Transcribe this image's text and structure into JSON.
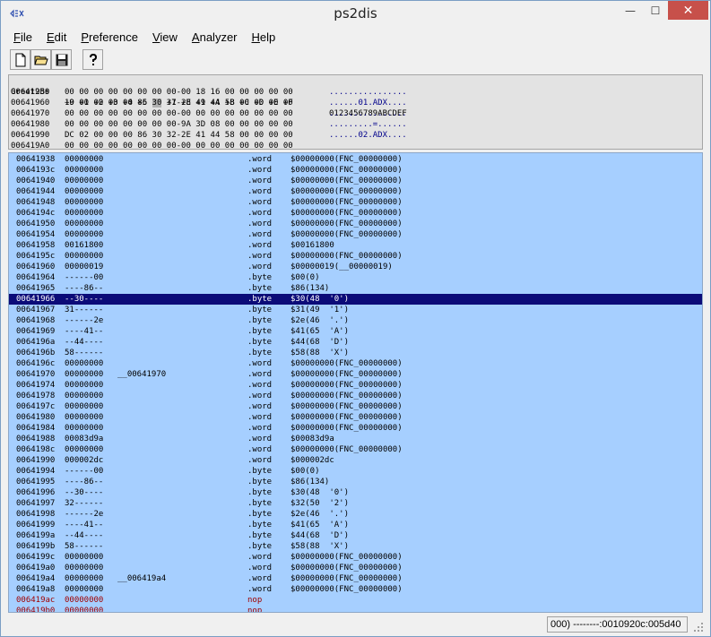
{
  "window": {
    "title": "ps2dis",
    "min_glyph": "—",
    "max_glyph": "☐",
    "close_glyph": "✕"
  },
  "menu": [
    {
      "key": "F",
      "rest": "ile"
    },
    {
      "key": "E",
      "rest": "dit"
    },
    {
      "key": "P",
      "rest": "reference"
    },
    {
      "key": "V",
      "rest": "iew"
    },
    {
      "key": "A",
      "rest": "nalyzer"
    },
    {
      "key": "H",
      "rest": "elp"
    }
  ],
  "toolbar": [
    "new-file-icon",
    "open-folder-icon",
    "save-disk-icon",
    "help-icon"
  ],
  "hexview": {
    "header": {
      "addr": "Greet2Bs",
      "bytes": "+0 +1 +2 +3 +4 +5 +6 +7 +8 +9 +A +B +C +D +E +F",
      "ascii": "0123456789ABCDEF"
    },
    "rows": [
      {
        "addr": "00641950",
        "bytes": "00 00 00 00 00 00 00 00-00 18 16 00 00 00 00 00",
        "ascii": "................"
      },
      {
        "addr": "00641960",
        "bytes": "19 00 00 00 00 86 30 31-2E 41 44 58 00 00 00 00",
        "ascii": "......01.ADX...."
      },
      {
        "addr": "00641970",
        "bytes": "00 00 00 00 00 00 00 00-00 00 00 00 00 00 00 00",
        "ascii": "................"
      },
      {
        "addr": "00641980",
        "bytes": "00 00 00 00 00 00 00 00-9A 3D 08 00 00 00 00 00",
        "ascii": ".........=......"
      },
      {
        "addr": "00641990",
        "bytes": "DC 02 00 00 00 86 30 32-2E 41 44 58 00 00 00 00",
        "ascii": "......02.ADX...."
      },
      {
        "addr": "006419A0",
        "bytes": "00 00 00 00 00 00 00 00-00 00 00 00 00 00 00 00",
        "ascii": ""
      }
    ]
  },
  "disasm": [
    {
      "addr": "00641938",
      "val": "00000000",
      "label": "",
      "op": ".word",
      "arg": "$00000000(FNC_00000000)"
    },
    {
      "addr": "0064193c",
      "val": "00000000",
      "label": "",
      "op": ".word",
      "arg": "$00000000(FNC_00000000)"
    },
    {
      "addr": "00641940",
      "val": "00000000",
      "label": "",
      "op": ".word",
      "arg": "$00000000(FNC_00000000)"
    },
    {
      "addr": "00641944",
      "val": "00000000",
      "label": "",
      "op": ".word",
      "arg": "$00000000(FNC_00000000)"
    },
    {
      "addr": "00641948",
      "val": "00000000",
      "label": "",
      "op": ".word",
      "arg": "$00000000(FNC_00000000)"
    },
    {
      "addr": "0064194c",
      "val": "00000000",
      "label": "",
      "op": ".word",
      "arg": "$00000000(FNC_00000000)"
    },
    {
      "addr": "00641950",
      "val": "00000000",
      "label": "",
      "op": ".word",
      "arg": "$00000000(FNC_00000000)"
    },
    {
      "addr": "00641954",
      "val": "00000000",
      "label": "",
      "op": ".word",
      "arg": "$00000000(FNC_00000000)"
    },
    {
      "addr": "00641958",
      "val": "00161800",
      "label": "",
      "op": ".word",
      "arg": "$00161800"
    },
    {
      "addr": "0064195c",
      "val": "00000000",
      "label": "",
      "op": ".word",
      "arg": "$00000000(FNC_00000000)"
    },
    {
      "addr": "00641960",
      "val": "00000019",
      "label": "",
      "op": ".word",
      "arg": "$00000019(__00000019)"
    },
    {
      "addr": "00641964",
      "val": "------00",
      "label": "",
      "op": ".byte",
      "arg": "$00(0)"
    },
    {
      "addr": "00641965",
      "val": "----86--",
      "label": "",
      "op": ".byte",
      "arg": "$86(134)"
    },
    {
      "addr": "00641966",
      "val": "--30----",
      "label": "",
      "op": ".byte",
      "arg": "$30(48  '0')"
    },
    {
      "addr": "00641967",
      "val": "31------",
      "label": "",
      "op": ".byte",
      "arg": "$31(49  '1')"
    },
    {
      "addr": "00641968",
      "val": "------2e",
      "label": "",
      "op": ".byte",
      "arg": "$2e(46  '.')"
    },
    {
      "addr": "00641969",
      "val": "----41--",
      "label": "",
      "op": ".byte",
      "arg": "$41(65  'A')"
    },
    {
      "addr": "0064196a",
      "val": "--44----",
      "label": "",
      "op": ".byte",
      "arg": "$44(68  'D')"
    },
    {
      "addr": "0064196b",
      "val": "58------",
      "label": "",
      "op": ".byte",
      "arg": "$58(88  'X')"
    },
    {
      "addr": "0064196c",
      "val": "00000000",
      "label": "",
      "op": ".word",
      "arg": "$00000000(FNC_00000000)"
    },
    {
      "addr": "00641970",
      "val": "00000000",
      "label": "__00641970",
      "op": ".word",
      "arg": "$00000000(FNC_00000000)"
    },
    {
      "addr": "00641974",
      "val": "00000000",
      "label": "",
      "op": ".word",
      "arg": "$00000000(FNC_00000000)"
    },
    {
      "addr": "00641978",
      "val": "00000000",
      "label": "",
      "op": ".word",
      "arg": "$00000000(FNC_00000000)"
    },
    {
      "addr": "0064197c",
      "val": "00000000",
      "label": "",
      "op": ".word",
      "arg": "$00000000(FNC_00000000)"
    },
    {
      "addr": "00641980",
      "val": "00000000",
      "label": "",
      "op": ".word",
      "arg": "$00000000(FNC_00000000)"
    },
    {
      "addr": "00641984",
      "val": "00000000",
      "label": "",
      "op": ".word",
      "arg": "$00000000(FNC_00000000)"
    },
    {
      "addr": "00641988",
      "val": "00083d9a",
      "label": "",
      "op": ".word",
      "arg": "$00083d9a"
    },
    {
      "addr": "0064198c",
      "val": "00000000",
      "label": "",
      "op": ".word",
      "arg": "$00000000(FNC_00000000)"
    },
    {
      "addr": "00641990",
      "val": "000002dc",
      "label": "",
      "op": ".word",
      "arg": "$000002dc"
    },
    {
      "addr": "00641994",
      "val": "------00",
      "label": "",
      "op": ".byte",
      "arg": "$00(0)"
    },
    {
      "addr": "00641995",
      "val": "----86--",
      "label": "",
      "op": ".byte",
      "arg": "$86(134)"
    },
    {
      "addr": "00641996",
      "val": "--30----",
      "label": "",
      "op": ".byte",
      "arg": "$30(48  '0')"
    },
    {
      "addr": "00641997",
      "val": "32------",
      "label": "",
      "op": ".byte",
      "arg": "$32(50  '2')"
    },
    {
      "addr": "00641998",
      "val": "------2e",
      "label": "",
      "op": ".byte",
      "arg": "$2e(46  '.')"
    },
    {
      "addr": "00641999",
      "val": "----41--",
      "label": "",
      "op": ".byte",
      "arg": "$41(65  'A')"
    },
    {
      "addr": "0064199a",
      "val": "--44----",
      "label": "",
      "op": ".byte",
      "arg": "$44(68  'D')"
    },
    {
      "addr": "0064199b",
      "val": "58------",
      "label": "",
      "op": ".byte",
      "arg": "$58(88  'X')"
    },
    {
      "addr": "0064199c",
      "val": "00000000",
      "label": "",
      "op": ".word",
      "arg": "$00000000(FNC_00000000)"
    },
    {
      "addr": "006419a0",
      "val": "00000000",
      "label": "",
      "op": ".word",
      "arg": "$00000000(FNC_00000000)"
    },
    {
      "addr": "006419a4",
      "val": "00000000",
      "label": "__006419a4",
      "op": ".word",
      "arg": "$00000000(FNC_00000000)"
    },
    {
      "addr": "006419a8",
      "val": "00000000",
      "label": "",
      "op": ".word",
      "arg": "$00000000(FNC_00000000)"
    },
    {
      "addr": "006419ac",
      "val": "00000000",
      "label": "",
      "op": "nop",
      "arg": ""
    },
    {
      "addr": "006419b0",
      "val": "00000000",
      "label": "",
      "op": "nop",
      "arg": ""
    }
  ],
  "selected_addr": "00641966",
  "status": {
    "text": "000) --------:0010920c:005d40"
  },
  "colors": {
    "pane_bg": "#a6cfff",
    "selection": "#0b0b78",
    "nop": "#a00000",
    "hex_bg": "#e3e3e3"
  }
}
